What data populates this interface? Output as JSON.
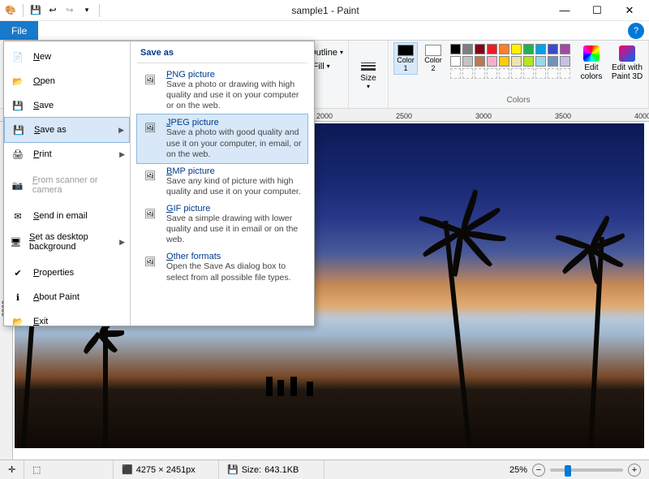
{
  "titlebar": {
    "doc": "sample1",
    "app": "Paint",
    "full": "sample1 - Paint"
  },
  "menubar": {
    "file": "File"
  },
  "ribbon": {
    "outline": "Outline",
    "fill": "Fill",
    "size": "Size",
    "color1": "Color\n1",
    "color2": "Color\n2",
    "edit_colors": "Edit\ncolors",
    "paint3d": "Edit with\nPaint 3D",
    "colors_label": "Colors",
    "color1_hex": "#000000",
    "color2_hex": "#ffffff",
    "palette_row1": [
      "#000",
      "#7f7f7f",
      "#880015",
      "#ed1c24",
      "#ff7f27",
      "#fff200",
      "#22b14c",
      "#00a2e8",
      "#3f48cc",
      "#a349a4"
    ],
    "palette_row2": [
      "#fff",
      "#c3c3c3",
      "#b97a57",
      "#ffaec9",
      "#ffc90e",
      "#efe4b0",
      "#b5e61d",
      "#99d9ea",
      "#7092be",
      "#c8bfe7"
    ],
    "palette_row3": [
      "",
      "",
      "",
      "",
      "",
      "",
      "",
      "",
      "",
      ""
    ]
  },
  "ruler": {
    "ticks": [
      "2000",
      "2500",
      "3000",
      "3500",
      "4000"
    ],
    "vticks": [
      "2000"
    ]
  },
  "statusbar": {
    "dimensions": "4275 × 2451px",
    "filesize": "643.1KB",
    "zoom": "25%"
  },
  "filemenu": {
    "left": [
      {
        "key": "new",
        "label": "New"
      },
      {
        "key": "open",
        "label": "Open"
      },
      {
        "key": "save",
        "label": "Save"
      },
      {
        "key": "saveas",
        "label": "Save as",
        "submenu": true,
        "selected": true
      },
      {
        "key": "print",
        "label": "Print",
        "submenu": true
      },
      {
        "key": "scanner",
        "label": "From scanner or camera",
        "disabled": true
      },
      {
        "key": "email",
        "label": "Send in email"
      },
      {
        "key": "desktop",
        "label": "Set as desktop background",
        "submenu": true
      },
      {
        "key": "properties",
        "label": "Properties"
      },
      {
        "key": "about",
        "label": "About Paint"
      },
      {
        "key": "exit",
        "label": "Exit"
      }
    ],
    "right_header": "Save as",
    "right": [
      {
        "key": "png",
        "title": "PNG picture",
        "desc": "Save a photo or drawing with high quality and use it on your computer or on the web."
      },
      {
        "key": "jpeg",
        "title": "JPEG picture",
        "desc": "Save a photo with good quality and use it on your computer, in email, or on the web.",
        "selected": true
      },
      {
        "key": "bmp",
        "title": "BMP picture",
        "desc": "Save any kind of picture with high quality and use it on your computer."
      },
      {
        "key": "gif",
        "title": "GIF picture",
        "desc": "Save a simple drawing with lower quality and use it in email or on the web."
      },
      {
        "key": "other",
        "title": "Other formats",
        "desc": "Open the Save As dialog box to select from all possible file types."
      }
    ]
  }
}
